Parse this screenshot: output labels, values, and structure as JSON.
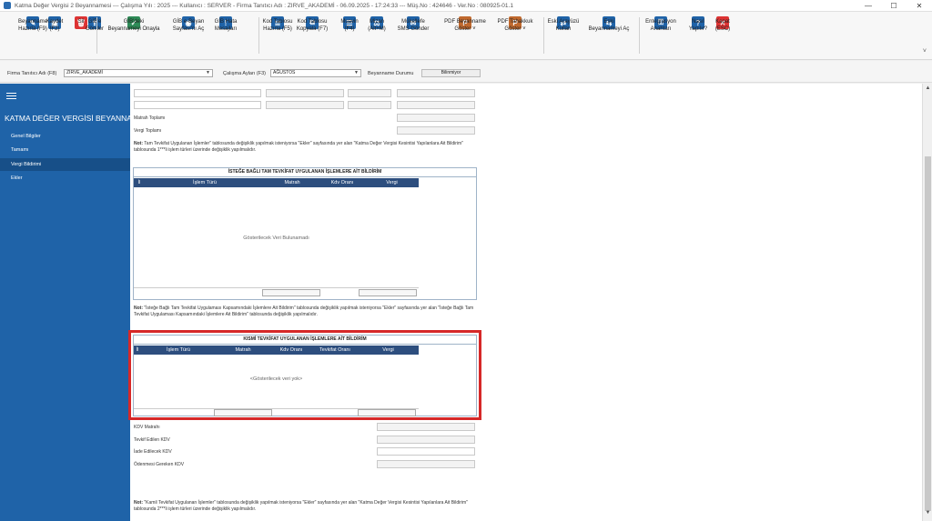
{
  "window": {
    "title": "Katma Değer Vergisi 2 Beyannamesi  ---  Çalışma Yılı : 2025  ---  Kullanıcı : SERVER  - Firma Tanıtıcı Adı : ZIRVE_AKADEMİ  - 06.09.2025 - 17:24:33  ---  Müş.No : 424646 - Ver.No : 080925-01.1",
    "controls": [
      "—",
      "☐",
      "✕"
    ]
  },
  "ribbon": {
    "buttons": [
      {
        "name": "beyanname-hazirla",
        "label": "Beyanname\nHazırla (F9)",
        "color": "#1f63a8",
        "glyph": "✎"
      },
      {
        "name": "kaydet",
        "label": "Kaydet\n(F2)",
        "color": "#1f63a8",
        "glyph": "▣"
      },
      {
        "name": "sil",
        "label": "Sil",
        "color": "#d33",
        "glyph": "🗑"
      },
      {
        "name": "gibe-gonder",
        "label": "GİB'e\nGönder",
        "color": "#1f63a8",
        "glyph": "⇪"
      },
      {
        "name": "gibdeki-beyannameyi-onayla",
        "label": "GİB'deki\nBeyannameyi Onayla",
        "color": "#2e8b57",
        "glyph": "✓"
      },
      {
        "name": "gib-e-beyan-sayfasini-ac",
        "label": "GİB e-Beyan\nSayfası'nı Aç",
        "color": "#1f63a8",
        "glyph": "◉"
      },
      {
        "name": "gib-hata-mesajlari",
        "label": "GİB Hata\nMesajları",
        "color": "#1f63a8",
        "glyph": "!"
      },
      {
        "name": "kod-tablosu-hazirla",
        "label": "Kod Tablosu\nHazırla (F5)",
        "color": "#1f63a8",
        "glyph": "≣"
      },
      {
        "name": "kod-tablosu-kopyala",
        "label": "Kod Tablosu\nKopyala (F7)",
        "color": "#1f63a8",
        "glyph": "⧉"
      },
      {
        "name": "muavin",
        "label": "Muavin\n(F4)",
        "color": "#1f63a8",
        "glyph": "☰"
      },
      {
        "name": "mizan",
        "label": "Mizan\n(Alt+M)",
        "color": "#1f63a8",
        "glyph": "⚖"
      },
      {
        "name": "mukellefe-sms-gonder",
        "label": "Mükellefe\nSMS Gönder",
        "color": "#1f63a8",
        "glyph": "✉"
      },
      {
        "name": "pdf-beyanname-goster",
        "label": "PDF Beyanname\nGöster  ˅",
        "color": "#c0692e",
        "glyph": "P"
      },
      {
        "name": "pdf-tahakkuk-goster",
        "label": "PDF Tahakkuk\nGöster  ˅",
        "color": "#c0692e",
        "glyph": "P"
      },
      {
        "name": "eski-arayuzu-kullan",
        "label": "Eski Arayüzü\nKullan",
        "color": "#1f63a8",
        "glyph": "⇄"
      },
      {
        "name": "eski-beyannameyi-ac",
        "label": "Eski\nBeyannameyi Aç",
        "color": "#1f63a8",
        "glyph": "⇆"
      },
      {
        "name": "entegrasyon-anahtari",
        "label": "Entegrasyon\nAnahtarı",
        "color": "#1f63a8",
        "glyph": "⚿"
      },
      {
        "name": "nasil-yapilir",
        "label": "Nasıl\nYapılır?",
        "color": "#1f63a8",
        "glyph": "?"
      },
      {
        "name": "kapat",
        "label": "Kapat\n(ESC)",
        "color": "#d33",
        "glyph": "✕"
      }
    ]
  },
  "filter": {
    "firma_label": "Firma Tanıtıcı Adı (F8)",
    "firma_value": "ZIRVE_AKADEMİ",
    "aylar_label": "Çalışma Ayları (F3)",
    "aylar_value": "AĞUSTOS",
    "durum_label": "Beyanname Durumu",
    "durum_value": "Bilinmiyor"
  },
  "sidebar": {
    "title": "KATMA  DEĞER VERGİSİ BEYANNAM...",
    "items": [
      {
        "label": "Genel Bilgiler",
        "active": false
      },
      {
        "label": "Tamamı",
        "active": false
      },
      {
        "label": "Vergi Bildirimi",
        "active": true
      },
      {
        "label": "Ekler",
        "active": false
      }
    ]
  },
  "main": {
    "matrah_toplami": "Matrah Toplamı",
    "vergi_toplami": "Vergi Toplamı",
    "note1_bold": "Not:",
    "note1": " Tam Tevkifat Uygulanan İşlemler\" tablosunda değişiklik yapılmak isteniyorsa \"Ekler\" sayfasında yer alan \"Katma Değer Vergisi Kesintisi Yapılanlara Ait Bildirim\" tablosunda 1***li işlem türleri üzerinde değişiklik yapılmalıdır.",
    "table1": {
      "title": "İSTEĞE BAĞLI TAM TEVKİFAT UYGULANAN İŞLEMLERE AİT BİLDİRİM",
      "columns": [
        "İl",
        "İşlem Türü",
        "Matrah",
        "Kdv Oranı",
        "Vergi"
      ],
      "empty": "Gösterilecek Veri Bulunamadı"
    },
    "note2_bold": "Not:",
    "note2": " \"İsteğe Bağlı Tam Tevkifat Uygulaması Kapsamındaki İşlemlere Ait Bildirim\" tablosunda değişiklik yapılmak isteniyorsa \"Ekler\" sayfasında yer alan \"İsteğe Bağlı Tam Tevkifat Uygulaması Kapsamındaki İşlemlere Ait Bildirim\" tablosunda değişiklik yapılmalıdır.",
    "table2": {
      "title": "KISMİ TEVKİFAT UYGULANAN İŞLEMLERE AİT BİLDİRİM",
      "columns": [
        "İl",
        "İşlem Türü",
        "Matrah",
        "Kdv Oranı",
        "Tevkifat Oranı",
        "Vergi"
      ],
      "empty": "<Gösterilecek veri yok>"
    },
    "kdv_matrahi": "KDV Matrahı",
    "tevkif_edilen_kdv": "Tevkif Edilen KDV",
    "iade_edilecek_kdv": "İade Edilecek KDV",
    "odenmesi_gereken_kdv": "Ödenmesi Gereken KDV",
    "note3_bold": "Not:",
    "note3": " \"Kamil Tevkifat Uygulanan İşlemler\" tablosunda değişiklik yapılmak isteniyorsa \"Ekler\" sayfasında yer alan \"Katma Değer Vergisi Kesintisi Yapılanlara Ait Bildirim\" tablosunda 2***li işlem türleri üzerinde değişiklik yapılmalıdır."
  },
  "colors": {
    "sidebar": "#1f63a8",
    "grid_header": "#2d4e7e",
    "highlight": "#d62828"
  }
}
